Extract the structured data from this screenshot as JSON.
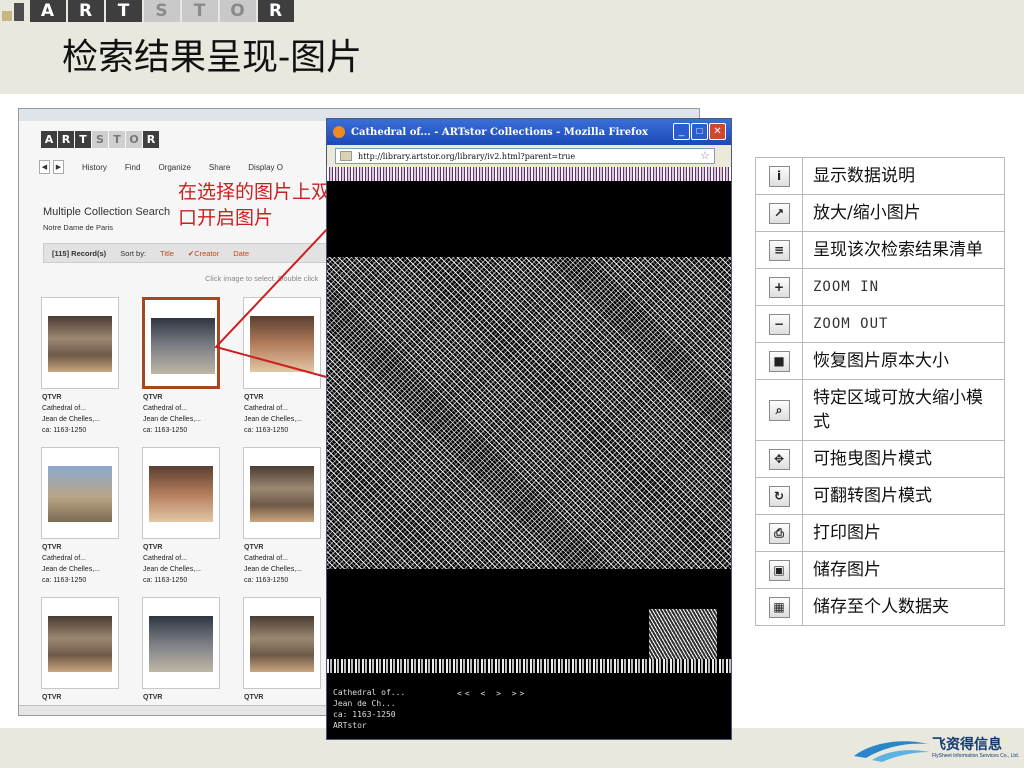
{
  "slide": {
    "brand_letters": [
      "A",
      "R",
      "T",
      "S",
      "T",
      "O",
      "R"
    ],
    "title": "检索结果呈现-图片",
    "callout": [
      "在选择的图片上双击滑鼠可打开新窗",
      "口开启图片"
    ]
  },
  "browser": {
    "logo_letters": [
      "A",
      "R",
      "T",
      "S",
      "T",
      "O",
      "R"
    ],
    "nav": [
      "History",
      "Find",
      "Organize",
      "Share",
      "Display O"
    ],
    "search_title": "Multiple Collection Search",
    "search_sub": "Notre Dame de Paris",
    "records": "[115] Record(s)",
    "sort_by": "Sort by:",
    "sort_options": [
      "Title",
      "✔Creator",
      "Date"
    ],
    "hint": "Click image to select. Double click",
    "results": [
      {
        "type": "QTVR",
        "title": "Cathedral of...",
        "creator": "Jean de Chelles,...",
        "date": "ca: 1163-1250"
      },
      {
        "type": "QTVR",
        "title": "Cathedral of...",
        "creator": "Jean de Chelles,...",
        "date": "ca: 1163-1250"
      },
      {
        "type": "QTVR",
        "title": "Cathedral of...",
        "creator": "Jean de Chelles,...",
        "date": "ca: 1163-1250"
      },
      {
        "type": "QTVR",
        "title": "Cathedral of...",
        "creator": "Jean de Chelles,...",
        "date": "ca: 1163-1250"
      },
      {
        "type": "QTVR",
        "title": "Cathedral of...",
        "creator": "Jean de Chelles,...",
        "date": "ca: 1163-1250"
      },
      {
        "type": "QTVR",
        "title": "Cathedral of...",
        "creator": "Jean de Chelles,...",
        "date": "ca: 1163-1250"
      },
      {
        "type": "QTVR"
      },
      {
        "type": "QTVR"
      },
      {
        "type": "QTVR"
      }
    ]
  },
  "popup": {
    "window_title": "Cathedral of... - ARTstor Collections - Mozilla Firefox",
    "url": "http://library.artstor.org/library/iv2.html?parent=true",
    "meta": [
      "Cathedral of...",
      "Jean de Ch...",
      "ca: 1163-1250",
      "ARTstor"
    ],
    "nav_text": "<< < > >>"
  },
  "legend": [
    {
      "icon": "info-icon",
      "glyph": "i",
      "label": "显示数据说明",
      "latin": false
    },
    {
      "icon": "enlarge-icon",
      "glyph": "↗",
      "label": "放大/缩小图片",
      "latin": false
    },
    {
      "icon": "list-icon",
      "glyph": "≡",
      "label": "呈现该次检索结果清单",
      "latin": false
    },
    {
      "icon": "zoom-in-icon",
      "glyph": "+",
      "label": "ZOOM IN",
      "latin": true
    },
    {
      "icon": "zoom-out-icon",
      "glyph": "−",
      "label": "ZOOM OUT",
      "latin": true
    },
    {
      "icon": "original-size-icon",
      "glyph": "■",
      "label": "恢复图片原本大小",
      "latin": false
    },
    {
      "icon": "region-zoom-icon",
      "glyph": "⌕",
      "label": "特定区域可放大缩小模式",
      "latin": false
    },
    {
      "icon": "drag-icon",
      "glyph": "✥",
      "label": "可拖曳图片模式",
      "latin": false
    },
    {
      "icon": "rotate-icon",
      "glyph": "↻",
      "label": "可翻转图片模式",
      "latin": false
    },
    {
      "icon": "print-icon",
      "glyph": "⎙",
      "label": "打印图片",
      "latin": false
    },
    {
      "icon": "save-icon",
      "glyph": "▣",
      "label": "储存图片",
      "latin": false
    },
    {
      "icon": "save-folder-icon",
      "glyph": "▦",
      "label": "储存至个人数据夹",
      "latin": false
    }
  ],
  "footer": {
    "company": "飞资得信息",
    "company_sub": "FlySheet Information Services Co., Ltd."
  }
}
